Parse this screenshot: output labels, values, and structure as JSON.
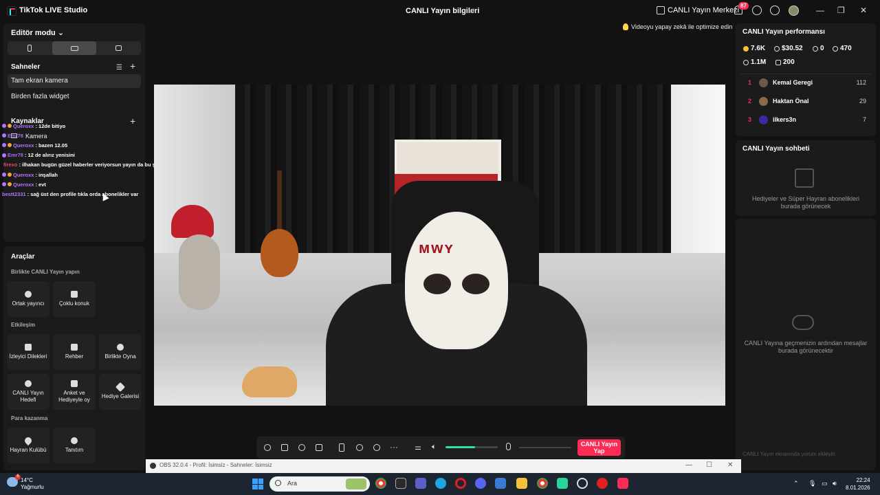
{
  "window": {
    "app_title": "TikTok LIVE Studio",
    "live_info": "CANLI Yayın bilgileri",
    "live_center": "CANLI Yayın Merkezi",
    "notification_count": "87"
  },
  "left": {
    "editor_mode": "Editör modu",
    "scenes_title": "Sahneler",
    "scenes": [
      "Tam ekran kamera",
      "Birden fazla widget"
    ],
    "sources_title": "Kaynaklar",
    "sources": [
      "Kamera"
    ]
  },
  "chat_overlay": [
    {
      "user": "Queroxx",
      "msg": ": 12de bitiyo"
    },
    {
      "user": "Emr78",
      "msg": ""
    },
    {
      "user": "Queroxx",
      "msg": ": bazen 12.05"
    },
    {
      "user": "Emr78",
      "msg": ": 12 de alırız yenisini"
    },
    {
      "user": "firexo",
      "msg": ": ilhakan bugün güzel haberler veriyorsun yayın da bu şekilde güzel olsun ve harika olsun"
    },
    {
      "user": "Queroxx",
      "msg": ": inşallah"
    },
    {
      "user": "Queroxx",
      "msg": ": evt"
    },
    {
      "user": "bestt2331",
      "msg": ": sağ üst den profile tıkla orda abonelikler var"
    }
  ],
  "tools": {
    "title": "Araçlar",
    "group1_title": "Birlikte CANLI Yayın yapın",
    "group1": [
      "Ortak yayıncı",
      "Çoklu konuk"
    ],
    "group2_title": "Etkileşim",
    "group2": [
      "İzleyici Dilekleri",
      "Rehber",
      "Birlikte Oyna",
      "CANLI Yayın Hedefi",
      "Anket ve Hediyeyle oy",
      "Hediye Galerisi"
    ],
    "group3_title": "Para kazanma",
    "group3": [
      "Hayran Kulübü",
      "Tanıtım"
    ]
  },
  "preview": {
    "optimize_hint": "Videoyu yapay zekâ ile optimize edin"
  },
  "toolbar": {
    "go_live": "CANLI Yayın Yap",
    "volume_fraction": 0.57
  },
  "performance": {
    "title": "CANLI Yayın performansı",
    "stats": [
      "7.6K",
      "$30.52",
      "0",
      "470",
      "1.1M",
      "200"
    ],
    "ranking": [
      {
        "rank": "1",
        "name": "Kemal Geregi",
        "value": "112"
      },
      {
        "rank": "2",
        "name": "Haktan Önal",
        "value": "29"
      },
      {
        "rank": "3",
        "name": "ilkers3n",
        "value": "7"
      }
    ]
  },
  "chat": {
    "title": "CANLI Yayın sohbeti",
    "gifts_empty": "Hediyeler ve Süper Hayran abonelikleri burada görünecek",
    "messages_empty": "CANLI Yayına geçmenizin ardından mesajlar burada görünecektir",
    "comment_placeholder": "CANLI Yayın ekranında yorum ekleyin"
  },
  "obs": {
    "title": "OBS 32.0.4 - Profil: İsimsiz - Sahneler: İsimsiz"
  },
  "taskbar": {
    "weather_temp": "14°C",
    "weather_desc": "Yağmurlu",
    "weather_badge": "6",
    "search_placeholder": "Ara",
    "time": "22:24",
    "date": "8.01.2026"
  },
  "colors": {
    "accent": "#fe2c55",
    "volume": "#2de2a6",
    "panel": "#1b1b1b"
  }
}
